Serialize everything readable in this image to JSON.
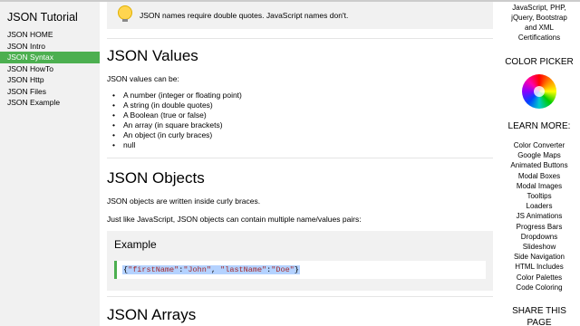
{
  "sidebar": {
    "title": "JSON Tutorial",
    "items": [
      {
        "label": "JSON HOME"
      },
      {
        "label": "JSON Intro"
      },
      {
        "label": "JSON Syntax",
        "active": true
      },
      {
        "label": "JSON HowTo"
      },
      {
        "label": "JSON Http"
      },
      {
        "label": "JSON Files"
      },
      {
        "label": "JSON Example"
      }
    ]
  },
  "main": {
    "note": "JSON names require double quotes. JavaScript names don't.",
    "values_section": {
      "heading": "JSON Values",
      "intro": "JSON values can be:",
      "items": [
        "A number (integer or floating point)",
        "A string (in double quotes)",
        "A Boolean (true or false)",
        "An array (in square brackets)",
        "An object (in curly braces)",
        "null"
      ]
    },
    "objects_section": {
      "heading": "JSON Objects",
      "p1": "JSON objects are written inside curly braces.",
      "p2": "Just like JavaScript, JSON objects can contain multiple name/values pairs:"
    },
    "example": {
      "title": "Example",
      "code_open": "{",
      "code_k1": "\"firstName\"",
      "code_colon1": ":",
      "code_v1": "\"John\"",
      "code_comma": ", ",
      "code_k2": "\"lastName\"",
      "code_colon2": ":",
      "code_v2": "\"Doe\"",
      "code_close": "}"
    },
    "arrays_section": {
      "heading": "JSON Arrays"
    }
  },
  "rightbar": {
    "top_lines": [
      "JavaScript, PHP,",
      "jQuery, Bootstrap",
      "and XML",
      "Certifications"
    ],
    "color_picker_title": "COLOR PICKER",
    "learn_more_title": "LEARN MORE:",
    "links": [
      "Color Converter",
      "Google Maps",
      "Animated Buttons",
      "Modal Boxes",
      "Modal Images",
      "Tooltips",
      "Loaders",
      "JS Animations",
      "Progress Bars",
      "Dropdowns",
      "Slideshow",
      "Side Navigation",
      "HTML Includes",
      "Color Palettes",
      "Code Coloring"
    ],
    "share_title_1": "SHARE THIS",
    "share_title_2": "PAGE"
  }
}
